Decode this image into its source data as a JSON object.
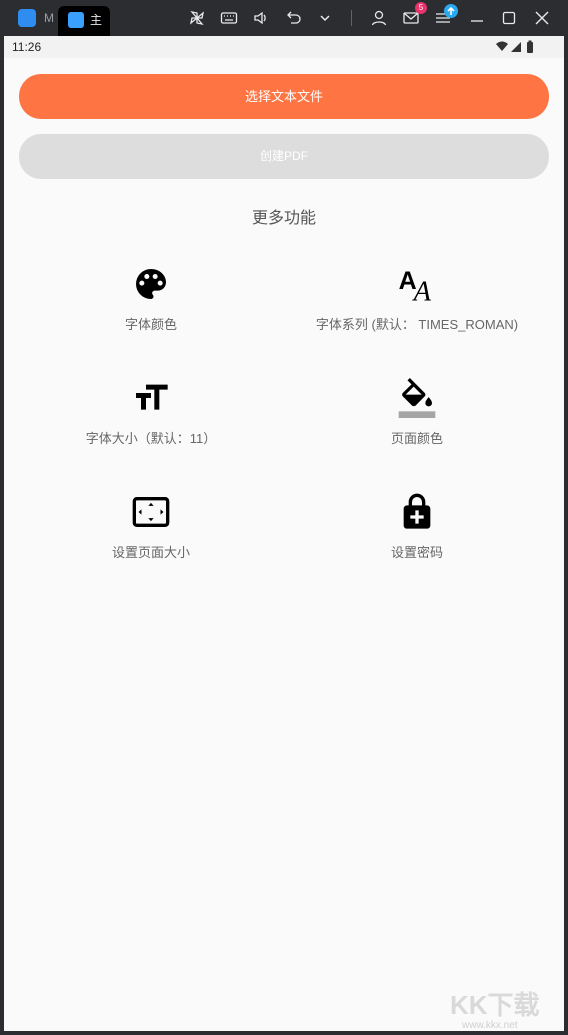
{
  "window": {
    "app_letter": "M",
    "tab_letter": "主",
    "mail_badge": "5"
  },
  "status_bar": {
    "time": "11:26"
  },
  "buttons": {
    "select_file": "选择文本文件",
    "create_pdf": "创建PDF"
  },
  "section_title": "更多功能",
  "features": [
    {
      "label": "字体颜色",
      "icon": "palette-icon"
    },
    {
      "label": "字体系列 (默认： TIMES_ROMAN)",
      "icon": "font-family-icon"
    },
    {
      "label": "字体大小（默认：11）",
      "icon": "text-size-icon"
    },
    {
      "label": "页面颜色",
      "icon": "paint-bucket-icon"
    },
    {
      "label": "设置页面大小",
      "icon": "aspect-ratio-icon"
    },
    {
      "label": "设置密码",
      "icon": "enhanced-encryption-icon"
    }
  ],
  "colors": {
    "accent": "#ff7443",
    "disabled_button": "#dddddd",
    "background": "#fafafa"
  },
  "watermark": {
    "text": "KK下载",
    "url": "www.kkx.net"
  }
}
